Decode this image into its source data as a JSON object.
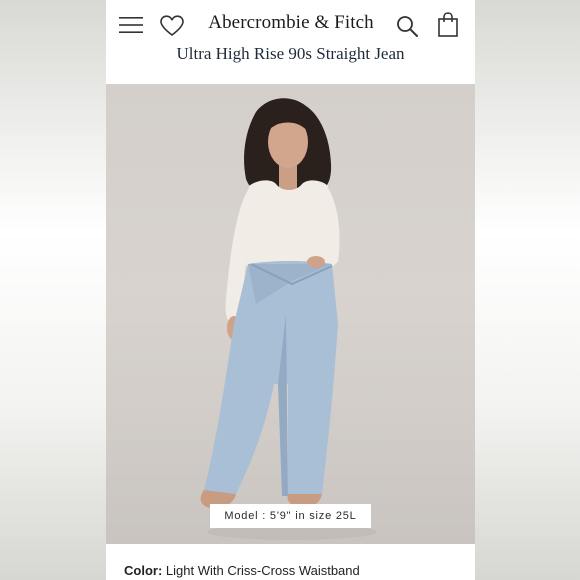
{
  "header": {
    "brand": "Abercrombie & Fitch",
    "product_title": "Ultra High Rise 90s Straight Jean",
    "icons": [
      "menu-icon",
      "heart-icon",
      "search-icon",
      "bag-icon"
    ]
  },
  "hero": {
    "model_info": "Model : 5'9\" in size 25L"
  },
  "details": {
    "color_label": "Color:",
    "color_value": "Light With Criss-Cross Waistband"
  },
  "colors": {
    "background": "#ffffff",
    "text": "#1b1b1b",
    "photo_background": "#d4cfcb",
    "denim": "#a9bfd6"
  }
}
